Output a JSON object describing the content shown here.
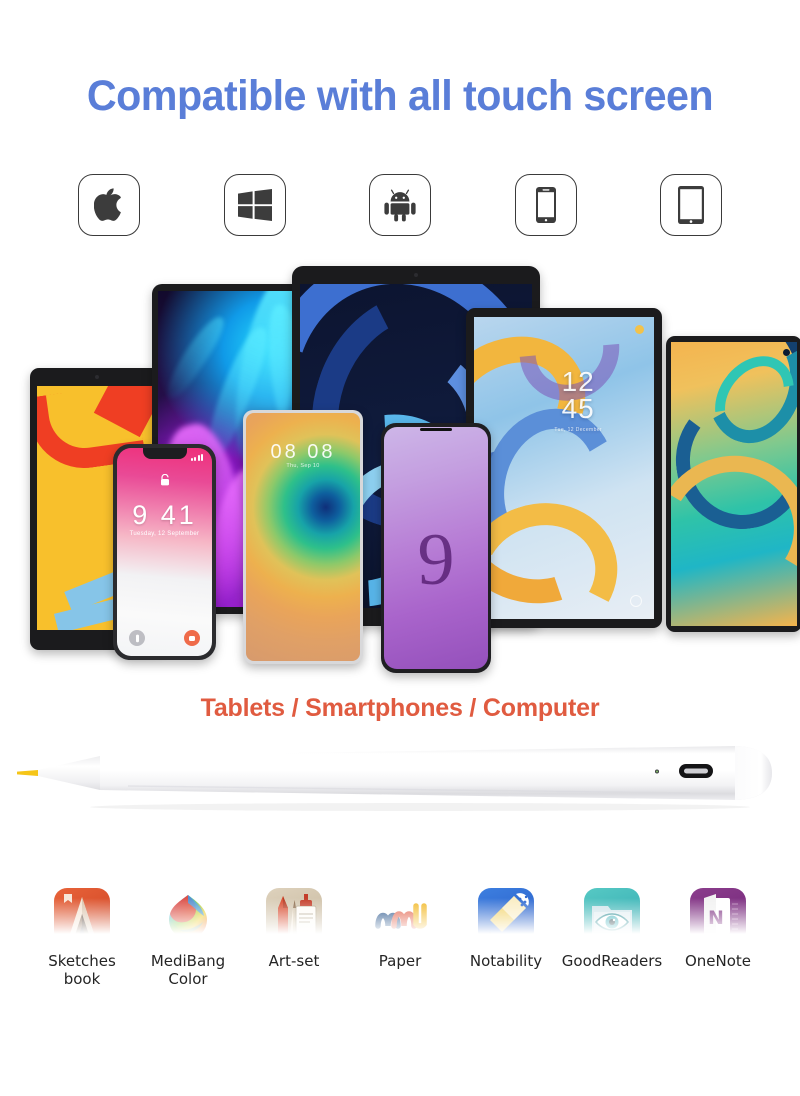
{
  "headline": "Compatible with all touch screen",
  "subtitle": "Tablets / Smartphones / Computer",
  "colors": {
    "headline_blue": "#5a7ed8",
    "subtitle_orange": "#e05b40",
    "background": "#ffffff",
    "badge_border": "#3a3a3a",
    "pen_body": "#ffffff",
    "pen_tip": "#f5c518"
  },
  "os_badges": [
    {
      "name": "apple-icon",
      "label": "Apple"
    },
    {
      "name": "windows-icon",
      "label": "Windows"
    },
    {
      "name": "android-icon",
      "label": "Android"
    },
    {
      "name": "smartphone-icon",
      "label": "Smartphone"
    },
    {
      "name": "tablet-icon",
      "label": "Tablet"
    }
  ],
  "devices": [
    {
      "name": "ipad-yellow",
      "type": "tablet",
      "screen_text": ""
    },
    {
      "name": "ipad-pro",
      "type": "tablet",
      "screen_text": ""
    },
    {
      "name": "ipad-air",
      "type": "tablet",
      "screen_text": ""
    },
    {
      "name": "galaxy-tab",
      "type": "tablet",
      "clock_hours": "12",
      "clock_minutes": "45",
      "date": "Tue, 12 December"
    },
    {
      "name": "huawei-matepad",
      "type": "tablet",
      "screen_text": ""
    },
    {
      "name": "iphone-x",
      "type": "smartphone",
      "clock": "9 41",
      "date": "Tuesday, 12 September"
    },
    {
      "name": "huawei-mate30",
      "type": "smartphone",
      "clock": "08 08",
      "date": "Thu, Sep 10"
    },
    {
      "name": "galaxy-s9",
      "type": "smartphone",
      "screen_text": "9"
    }
  ],
  "pen": {
    "name": "stylus-pen",
    "tip_color": "#f5c518",
    "port": "usb-c",
    "led": "indicator-led"
  },
  "apps": [
    {
      "name": "sketches-book",
      "label": "Sketches\nbook"
    },
    {
      "name": "medibang-color",
      "label": "MediBang\nColor"
    },
    {
      "name": "art-set",
      "label": "Art-set"
    },
    {
      "name": "paper",
      "label": "Paper"
    },
    {
      "name": "notability",
      "label": "Notability"
    },
    {
      "name": "goodreaders",
      "label": "GoodReaders"
    },
    {
      "name": "onenote",
      "label": "OneNote"
    }
  ]
}
